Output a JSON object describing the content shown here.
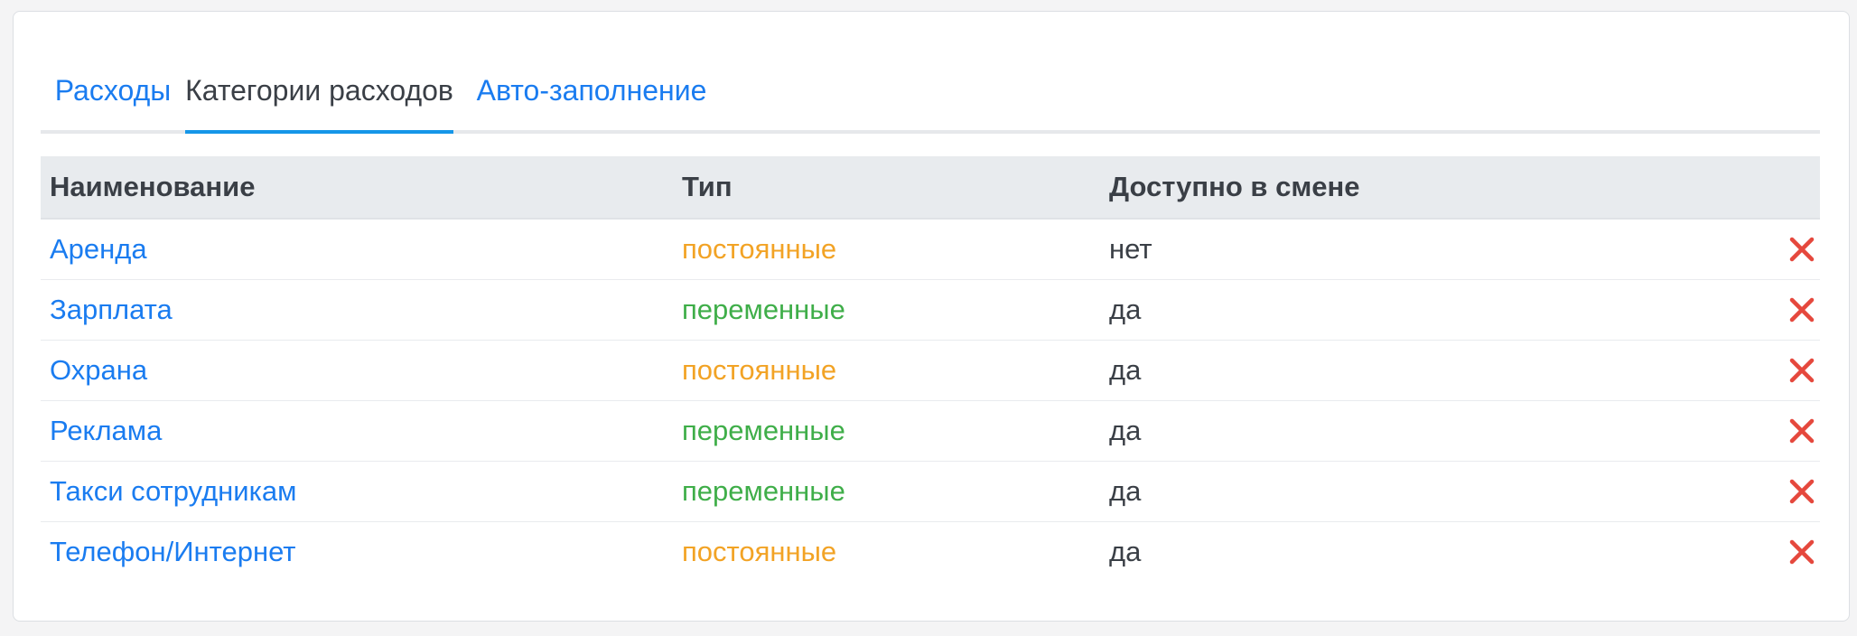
{
  "tabs": [
    {
      "label": "Расходы",
      "active": false
    },
    {
      "label": "Категории расходов",
      "active": true
    },
    {
      "label": "Авто-заполнение",
      "active": false
    }
  ],
  "table": {
    "headers": {
      "name": "Наименование",
      "type": "Тип",
      "available": "Доступно в смене"
    },
    "rows": [
      {
        "name": "Аренда",
        "type": "постоянные",
        "available": "нет"
      },
      {
        "name": "Зарплата",
        "type": "переменные",
        "available": "да"
      },
      {
        "name": "Охрана",
        "type": "постоянные",
        "available": "да"
      },
      {
        "name": "Реклама",
        "type": "переменные",
        "available": "да"
      },
      {
        "name": "Такси сотрудникам",
        "type": "переменные",
        "available": "да"
      },
      {
        "name": "Телефон/Интернет",
        "type": "постоянные",
        "available": "да"
      }
    ],
    "delete_icon": "close-icon"
  },
  "colors": {
    "link": "#1a7cf0",
    "tab_active_underline": "#1596e8",
    "type_constant": "#f2a325",
    "type_variable": "#3fae49",
    "delete": "#e5483d"
  }
}
